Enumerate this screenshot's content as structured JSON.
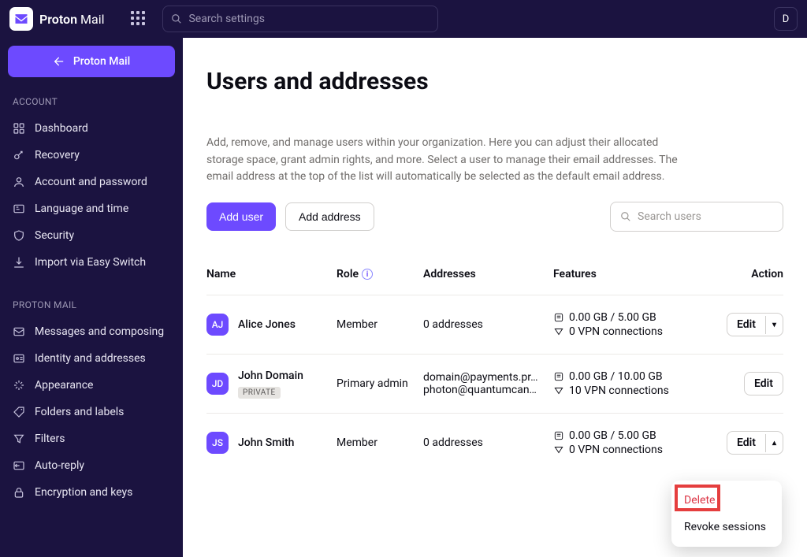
{
  "app": {
    "brandA": "Proton",
    "brandB": "Mail"
  },
  "search_settings_placeholder": "Search settings",
  "avatar_initial": "D",
  "back_label": "Proton Mail",
  "sidebar": {
    "section1_label": "ACCOUNT",
    "section2_label": "PROTON MAIL",
    "items1": [
      {
        "label": "Dashboard"
      },
      {
        "label": "Recovery"
      },
      {
        "label": "Account and password"
      },
      {
        "label": "Language and time"
      },
      {
        "label": "Security"
      },
      {
        "label": "Import via Easy Switch"
      }
    ],
    "items2": [
      {
        "label": "Messages and composing"
      },
      {
        "label": "Identity and addresses"
      },
      {
        "label": "Appearance"
      },
      {
        "label": "Folders and labels"
      },
      {
        "label": "Filters"
      },
      {
        "label": "Auto-reply"
      },
      {
        "label": "Encryption and keys"
      }
    ]
  },
  "page": {
    "title": "Users and addresses",
    "description": "Add, remove, and manage users within your organization. Here you can adjust their allocated storage space, grant admin rights, and more. Select a user to manage their email addresses. The email address at the top of the list will automatically be selected as the default email address.",
    "add_user_label": "Add user",
    "add_address_label": "Add address",
    "search_users_placeholder": "Search users",
    "columns": {
      "name": "Name",
      "role": "Role",
      "addresses": "Addresses",
      "features": "Features",
      "action": "Action"
    },
    "rows": [
      {
        "initials": "AJ",
        "name": "Alice Jones",
        "private": false,
        "role": "Member",
        "addresses_text": "0 addresses",
        "addresses": [],
        "storage": "0.00 GB / 5.00 GB",
        "vpn": "0 VPN connections",
        "edit_label": "Edit",
        "has_caret": true,
        "caret": "▾"
      },
      {
        "initials": "JD",
        "name": "John Domain",
        "private": true,
        "private_label": "PRIVATE",
        "role": "Primary ad­min",
        "addresses_text": "",
        "addresses": [
          "domain@payments.pr…",
          "photon@quantumcan…"
        ],
        "storage": "0.00 GB / 10.00 GB",
        "vpn": "10 VPN connections",
        "edit_label": "Edit",
        "has_caret": false
      },
      {
        "initials": "JS",
        "name": "John Smith",
        "private": false,
        "role": "Member",
        "addresses_text": "0 addresses",
        "addresses": [],
        "storage": "0.00 GB / 5.00 GB",
        "vpn": "0 VPN connections",
        "edit_label": "Edit",
        "has_caret": true,
        "caret": "▴"
      }
    ],
    "dropdown": {
      "delete": "Delete",
      "revoke": "Revoke sessions"
    }
  }
}
